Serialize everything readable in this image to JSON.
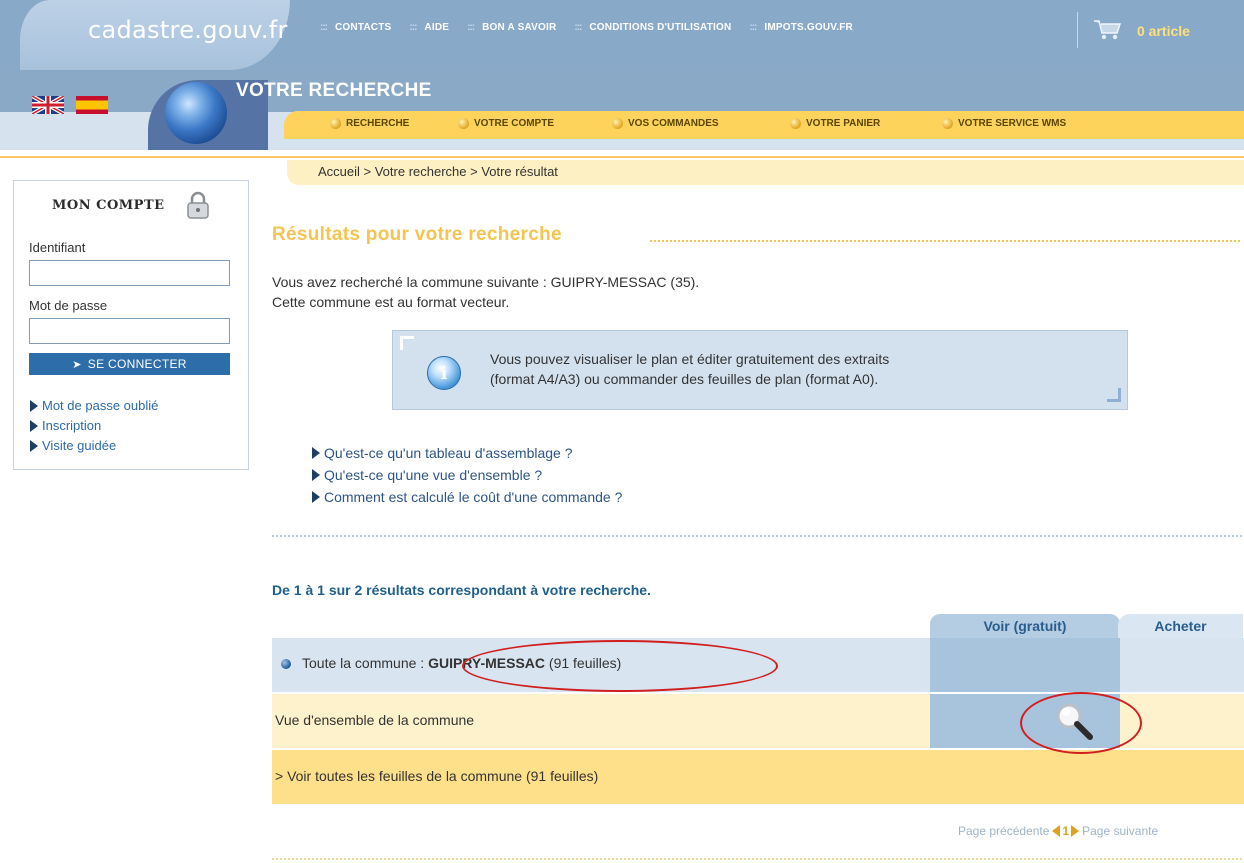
{
  "site": {
    "logo": "cadastre.gouv.fr"
  },
  "topnav": [
    {
      "label": "CONTACTS"
    },
    {
      "label": "AIDE"
    },
    {
      "label": "BON A SAVOIR"
    },
    {
      "label": "CONDITIONS D'UTILISATION"
    },
    {
      "label": "IMPOTS.GOUV.FR"
    }
  ],
  "cart": {
    "label": "0 article",
    "icon": "cart-icon"
  },
  "section": {
    "title": "VOTRE RECHERCHE"
  },
  "subnav": [
    {
      "label": "RECHERCHE"
    },
    {
      "label": "VOTRE COMPTE"
    },
    {
      "label": "VOS COMMANDES"
    },
    {
      "label": "VOTRE PANIER"
    },
    {
      "label": "VOTRE SERVICE WMS"
    }
  ],
  "breadcrumb": "Accueil > Votre recherche > Votre résultat",
  "account": {
    "title": "MON COMPTE",
    "id_label": "Identifiant",
    "id_value": "",
    "pw_label": "Mot de passe",
    "pw_value": "",
    "login_button": "SE CONNECTER",
    "links": [
      "Mot de passe oublié",
      "Inscription",
      "Visite guidée"
    ]
  },
  "main": {
    "title": "Résultats pour votre recherche",
    "intro_line1": "Vous avez recherché la commune suivante : GUIPRY-MESSAC (35).",
    "intro_line2": "Cette commune est au format vecteur.",
    "info_line1": "Vous pouvez visualiser le plan et éditer gratuitement des extraits",
    "info_line2": "(format A4/A3) ou commander des feuilles de plan (format A0).",
    "faq": [
      "Qu'est-ce qu'un tableau d'assemblage ?",
      "Qu'est-ce qu'une vue d'ensemble ?",
      "Comment est calculé le coût d'une commande ?"
    ],
    "results_count": "De 1 à 1 sur 2 résultats correspondant à votre recherche."
  },
  "tabs": {
    "voir": "Voir (gratuit)",
    "acheter": "Acheter"
  },
  "rows": {
    "commune_prefix": "Toute la commune : ",
    "commune_name": "GUIPRY-MESSAC",
    "commune_suffix": " (91 feuilles)",
    "overview": "Vue d'ensemble de la commune",
    "all_sheets": "> Voir toutes les feuilles de la commune (91 feuilles)"
  },
  "pager": {
    "prev": "Page précédente",
    "current": "1",
    "next": "Page suivante"
  },
  "colors": {
    "top_blue": "#89a9c8",
    "yellow": "#fdd35c",
    "title_gold": "#f5c451",
    "annotation_red": "#d11f1f"
  }
}
